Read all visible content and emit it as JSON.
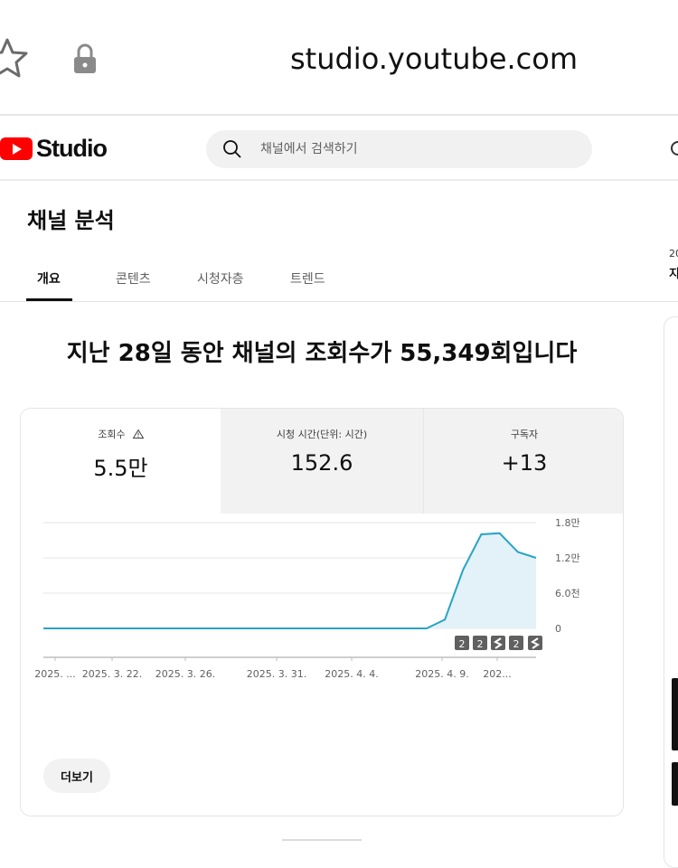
{
  "browser": {
    "url": "studio.youtube.com"
  },
  "header": {
    "logo_text": "Studio",
    "search_placeholder": "채널에서 검색하기"
  },
  "page": {
    "title": "채널 분석",
    "tabs": [
      {
        "label": "개요",
        "active": true
      },
      {
        "label": "콘텐츠",
        "active": false
      },
      {
        "label": "시청자층",
        "active": false
      },
      {
        "label": "트렌드",
        "active": false
      }
    ],
    "side_peek_small": "20",
    "side_peek_bold": "지"
  },
  "overview": {
    "headline": "지난 28일 동안 채널의 조회수가 55,349회입니다",
    "metrics": [
      {
        "label": "조회수",
        "value": "5.5만",
        "selected": true,
        "warning": true
      },
      {
        "label": "시청 시간(단위: 시간)",
        "value": "152.6",
        "selected": false
      },
      {
        "label": "구독자",
        "value": "+13",
        "selected": false
      }
    ],
    "more_button": "더보기"
  },
  "chart_data": {
    "type": "area",
    "x_tick_labels": [
      "2025. ...",
      "2025. 3. 22.",
      "2025. 3. 26.",
      "2025. 3. 31.",
      "2025. 4. 4.",
      "2025. 4. 9.",
      "202..."
    ],
    "y_tick_labels": [
      "1.8만",
      "1.2만",
      "6.0천",
      "0"
    ],
    "ylim": [
      0,
      18000
    ],
    "x": [
      "2025-03-18",
      "2025-03-19",
      "2025-03-20",
      "2025-03-21",
      "2025-03-22",
      "2025-03-23",
      "2025-03-24",
      "2025-03-25",
      "2025-03-26",
      "2025-03-27",
      "2025-03-28",
      "2025-03-29",
      "2025-03-30",
      "2025-03-31",
      "2025-04-01",
      "2025-04-02",
      "2025-04-03",
      "2025-04-04",
      "2025-04-05",
      "2025-04-06",
      "2025-04-07",
      "2025-04-08",
      "2025-04-09",
      "2025-04-10",
      "2025-04-11",
      "2025-04-12",
      "2025-04-13",
      "2025-04-14"
    ],
    "values": [
      0,
      0,
      0,
      0,
      0,
      0,
      0,
      0,
      0,
      0,
      0,
      0,
      0,
      0,
      0,
      0,
      0,
      0,
      0,
      0,
      0,
      0,
      1500,
      10000,
      16000,
      16200,
      13000,
      12000
    ],
    "marker_labels": [
      "2",
      "2",
      "",
      "2",
      ""
    ],
    "colors": {
      "line": "#28a4c4",
      "fill": "#e3f1f8",
      "grid": "#e6e6e6",
      "axis": "#bdbdbd"
    }
  }
}
